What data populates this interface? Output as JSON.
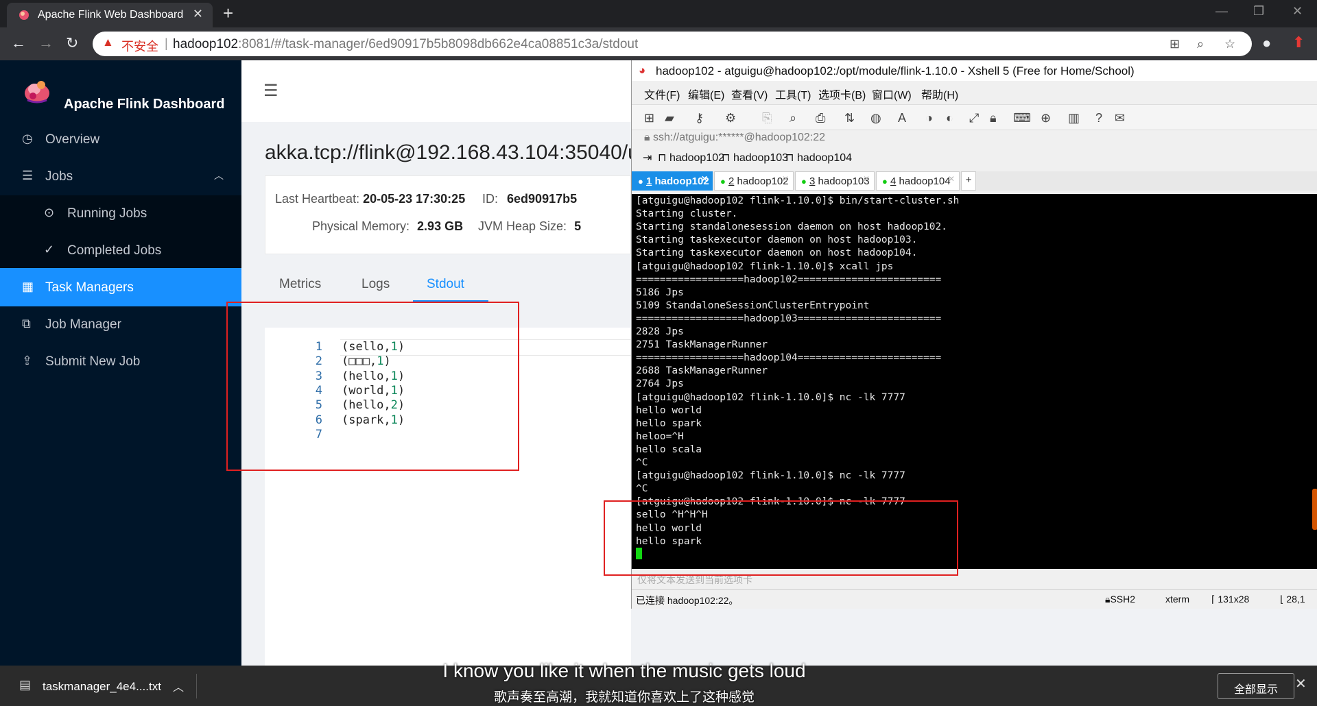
{
  "browser": {
    "tab_title": "Apache Flink Web Dashboard",
    "insecure_label": "不安全",
    "url_host": "hadoop102",
    "url_path": ":8081/#/task-manager/6ed90917b5b8098db662e4ca08851c3a/stdout",
    "icons": [
      "back-icon",
      "forward-icon",
      "reload-icon",
      "warning-icon",
      "translate-icon",
      "zoom-icon",
      "star-icon",
      "account-icon",
      "update-icon"
    ]
  },
  "sidebar": {
    "brand": "Apache Flink Dashboard",
    "items": [
      {
        "label": "Overview",
        "icon": "dashboard-icon"
      },
      {
        "label": "Jobs",
        "icon": "list-icon"
      },
      {
        "label": "Running Jobs",
        "icon": "play-circle-icon"
      },
      {
        "label": "Completed Jobs",
        "icon": "check-circle-icon"
      },
      {
        "label": "Task Managers",
        "icon": "schedule-icon"
      },
      {
        "label": "Job Manager",
        "icon": "cluster-icon"
      },
      {
        "label": "Submit New Job",
        "icon": "upload-icon"
      }
    ],
    "active_color": "#1890ff",
    "bg_color": "#001529"
  },
  "main": {
    "title": "akka.tcp://flink@192.168.43.104:35040/u",
    "last_heartbeat_label": "Last Heartbeat:",
    "last_heartbeat_value": "20-05-23 17:30:25",
    "id_label": "ID:",
    "id_value": "6ed90917b5",
    "physical_memory_label": "Physical Memory:",
    "physical_memory_value": "2.93 GB",
    "jvm_heap_label": "JVM Heap Size:",
    "jvm_heap_value": "5",
    "tabs": [
      "Metrics",
      "Logs",
      "Stdout"
    ],
    "active_tab": "Stdout",
    "stdout_lines": [
      {
        "n": "1",
        "pre": "(sello,",
        "num": "1",
        "post": ")"
      },
      {
        "n": "2",
        "pre": "(□□□,",
        "num": "1",
        "post": ")"
      },
      {
        "n": "3",
        "pre": "(hello,",
        "num": "1",
        "post": ")"
      },
      {
        "n": "4",
        "pre": "(world,",
        "num": "1",
        "post": ")"
      },
      {
        "n": "5",
        "pre": "(hello,",
        "num": "2",
        "post": ")"
      },
      {
        "n": "6",
        "pre": "(spark,",
        "num": "1",
        "post": ")"
      },
      {
        "n": "7",
        "pre": "",
        "num": "",
        "post": ""
      }
    ]
  },
  "xshell": {
    "title": "hadoop102 - atguigu@hadoop102:/opt/module/flink-1.10.0 - Xshell 5 (Free for Home/School)",
    "menu": [
      "文件(F)",
      "编辑(E)",
      "查看(V)",
      "工具(T)",
      "选项卡(B)",
      "窗口(W)",
      "帮助(H)"
    ],
    "address": "ssh://atguigu:******@hadoop102:22",
    "links": [
      "hadoop102",
      "hadoop103",
      "hadoop104"
    ],
    "tabs": [
      {
        "num": "1",
        "name": "hadoop102"
      },
      {
        "num": "2",
        "name": "hadoop102"
      },
      {
        "num": "3",
        "name": "hadoop103"
      },
      {
        "num": "4",
        "name": "hadoop104"
      }
    ],
    "terminal_lines": [
      "[atguigu@hadoop102 flink-1.10.0]$ bin/start-cluster.sh",
      "Starting cluster.",
      "Starting standalonesession daemon on host hadoop102.",
      "Starting taskexecutor daemon on host hadoop103.",
      "Starting taskexecutor daemon on host hadoop104.",
      "[atguigu@hadoop102 flink-1.10.0]$ xcall jps",
      "==================hadoop102========================",
      "5186 Jps",
      "5109 StandaloneSessionClusterEntrypoint",
      "==================hadoop103========================",
      "2828 Jps",
      "2751 TaskManagerRunner",
      "==================hadoop104========================",
      "2688 TaskManagerRunner",
      "2764 Jps",
      "[atguigu@hadoop102 flink-1.10.0]$ nc -lk 7777",
      "hello world",
      "hello spark",
      "heloo=^H",
      "hello scala",
      "^C",
      "[atguigu@hadoop102 flink-1.10.0]$ nc -lk 7777",
      "^C",
      "[atguigu@hadoop102 flink-1.10.0]$ nc -lk 7777",
      "sello ^H^H^H",
      "hello world",
      "hello spark"
    ],
    "send_hint": "仅将文本发送到当前选项卡",
    "status_connected": "已连接 hadoop102:22。",
    "status_protocol": "SSH2",
    "status_term": "xterm",
    "status_size": "131x28",
    "status_pos": "28,1"
  },
  "downloads": {
    "file_name": "taskmanager_4e4....txt",
    "show_all": "全部显示"
  },
  "subtitles": {
    "en": "I know you like it when the music gets loud",
    "zh": "歌声奏至高潮，我就知道你喜欢上了这种感觉"
  }
}
